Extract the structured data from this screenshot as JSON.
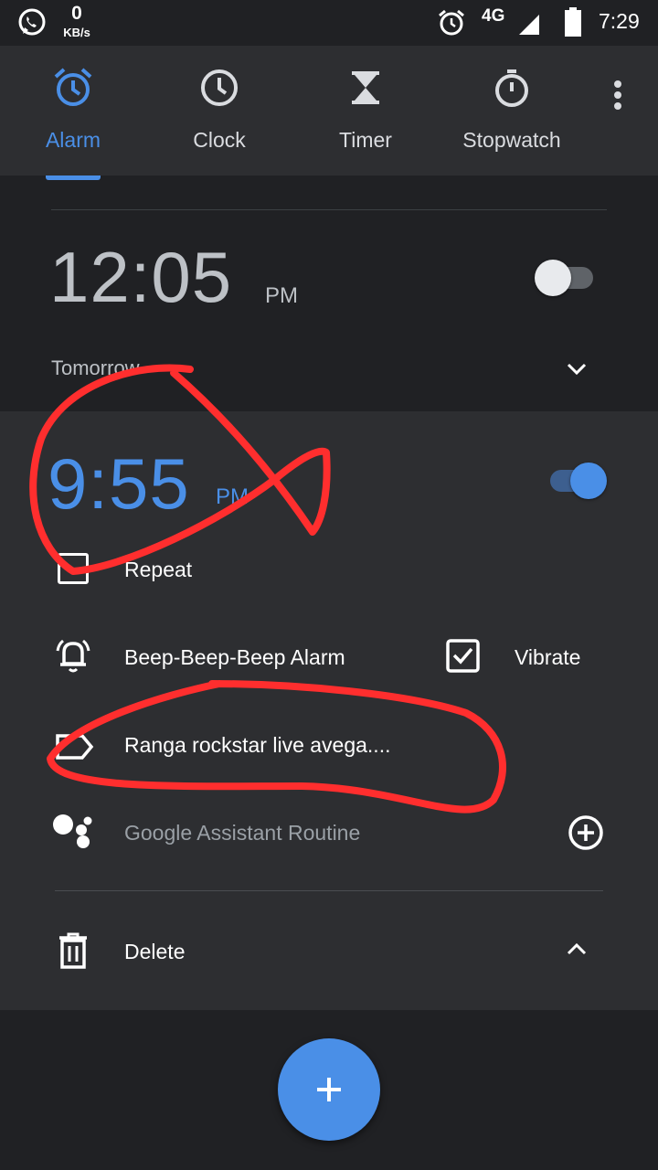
{
  "status_bar": {
    "net_speed_value": "0",
    "net_speed_unit": "KB/s",
    "network": "4G",
    "time": "7:29",
    "icons": [
      "whatsapp-icon",
      "alarm-icon",
      "signal-icon",
      "battery-icon"
    ]
  },
  "tabs": [
    {
      "label": "Alarm",
      "icon": "alarm-icon",
      "active": true
    },
    {
      "label": "Clock",
      "icon": "clock-icon",
      "active": false
    },
    {
      "label": "Timer",
      "icon": "hourglass-icon",
      "active": false
    },
    {
      "label": "Stopwatch",
      "icon": "stopwatch-icon",
      "active": false
    }
  ],
  "alarms": [
    {
      "time": "12:05",
      "ampm": "PM",
      "enabled": false,
      "schedule": "Tomorrow"
    },
    {
      "time": "9:55",
      "ampm": "PM",
      "enabled": true,
      "repeat_label": "Repeat",
      "sound_label": "Beep-Beep-Beep Alarm",
      "vibrate_label": "Vibrate",
      "vibrate_checked": true,
      "alarm_label": "Ranga rockstar live avega....",
      "assistant_label": "Google Assistant Routine",
      "delete_label": "Delete"
    }
  ],
  "colors": {
    "accent": "#4a8fe7",
    "background": "#202124",
    "card": "#2d2e31",
    "annotation": "#ff2e2e"
  }
}
